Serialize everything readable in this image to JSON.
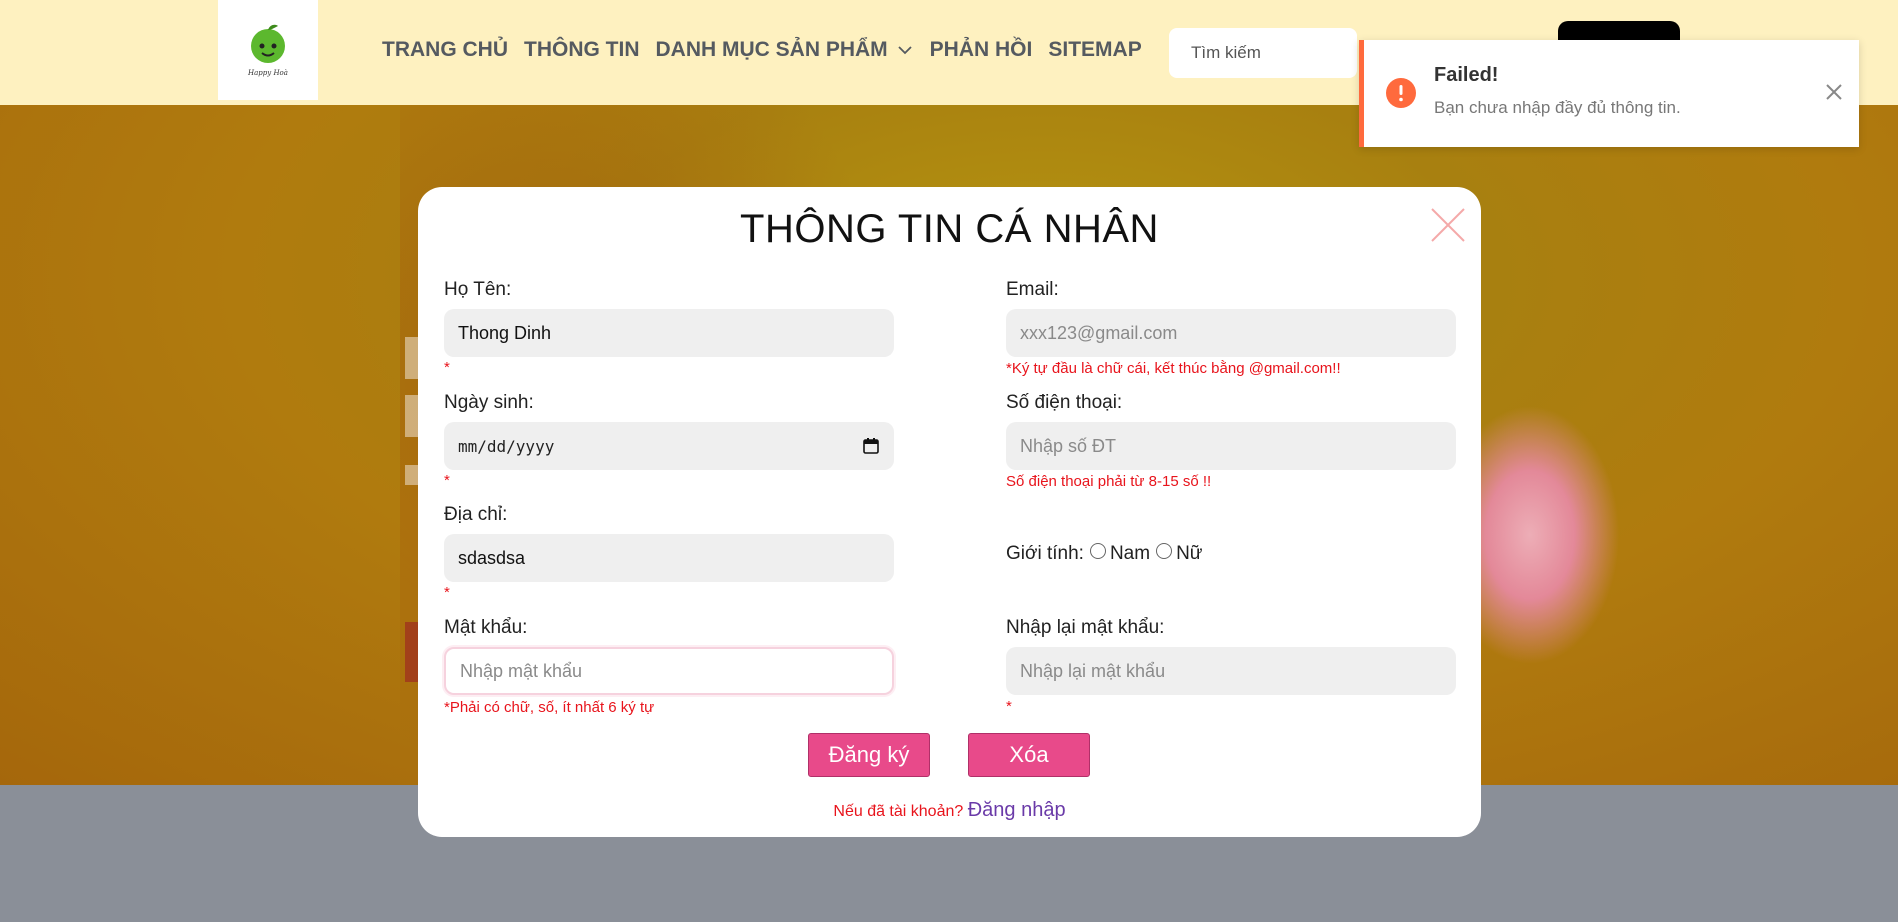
{
  "header": {
    "logo_text": "Happy Hoà",
    "nav": [
      {
        "label": "TRANG CHỦ"
      },
      {
        "label": "THÔNG TIN"
      },
      {
        "label": "DANH MỤC SẢN PHẨM",
        "has_dropdown": true
      },
      {
        "label": "PHẢN HỒI"
      },
      {
        "label": "SITEMAP"
      }
    ],
    "search_placeholder": "Tìm kiếm"
  },
  "modal": {
    "title": "THÔNG TIN CÁ NHÂN",
    "fields": {
      "name": {
        "label": "Họ Tên:",
        "value": "Thong Dinh",
        "note": "*"
      },
      "email": {
        "label": "Email:",
        "value": "",
        "placeholder": "xxx123@gmail.com",
        "note": "*Ký tự đầu là chữ cái, kết thúc bằng @gmail.com!!"
      },
      "dob": {
        "label": "Ngày sinh:",
        "value": "mm/dd/yyyy",
        "note": "*"
      },
      "phone": {
        "label": "Số điện thoại:",
        "value": "",
        "placeholder": "Nhập số ĐT",
        "note": "Số điện thoại phải từ 8-15 số !!"
      },
      "address": {
        "label": "Địa chỉ:",
        "value": "sdasdsa",
        "note": "*"
      },
      "gender": {
        "label": "Giới tính:",
        "options": [
          "Nam",
          "Nữ"
        ],
        "selected": null
      },
      "password": {
        "label": "Mật khẩu:",
        "value": "",
        "placeholder": "Nhập mật khẩu",
        "note": "*Phải có chữ, số, ít nhất 6 ký tự"
      },
      "password_confirm": {
        "label": "Nhập lại mật khẩu:",
        "value": "",
        "placeholder": "Nhập lại mật khẩu",
        "note": "*"
      }
    },
    "register_button": "Đăng ký",
    "clear_button": "Xóa",
    "footer_prompt": "Nếu đã tài khoản?",
    "login_link": "Đăng nhập"
  },
  "toast": {
    "title": "Failed!",
    "message": "Bạn chưa nhập đầy đủ thông tin.",
    "accent_color": "#ff6a3d"
  },
  "colors": {
    "header_bg": "#fef1c0",
    "button_pink": "#e84a8a",
    "error_red": "#e8141c",
    "link_purple": "#6a3aa8"
  }
}
